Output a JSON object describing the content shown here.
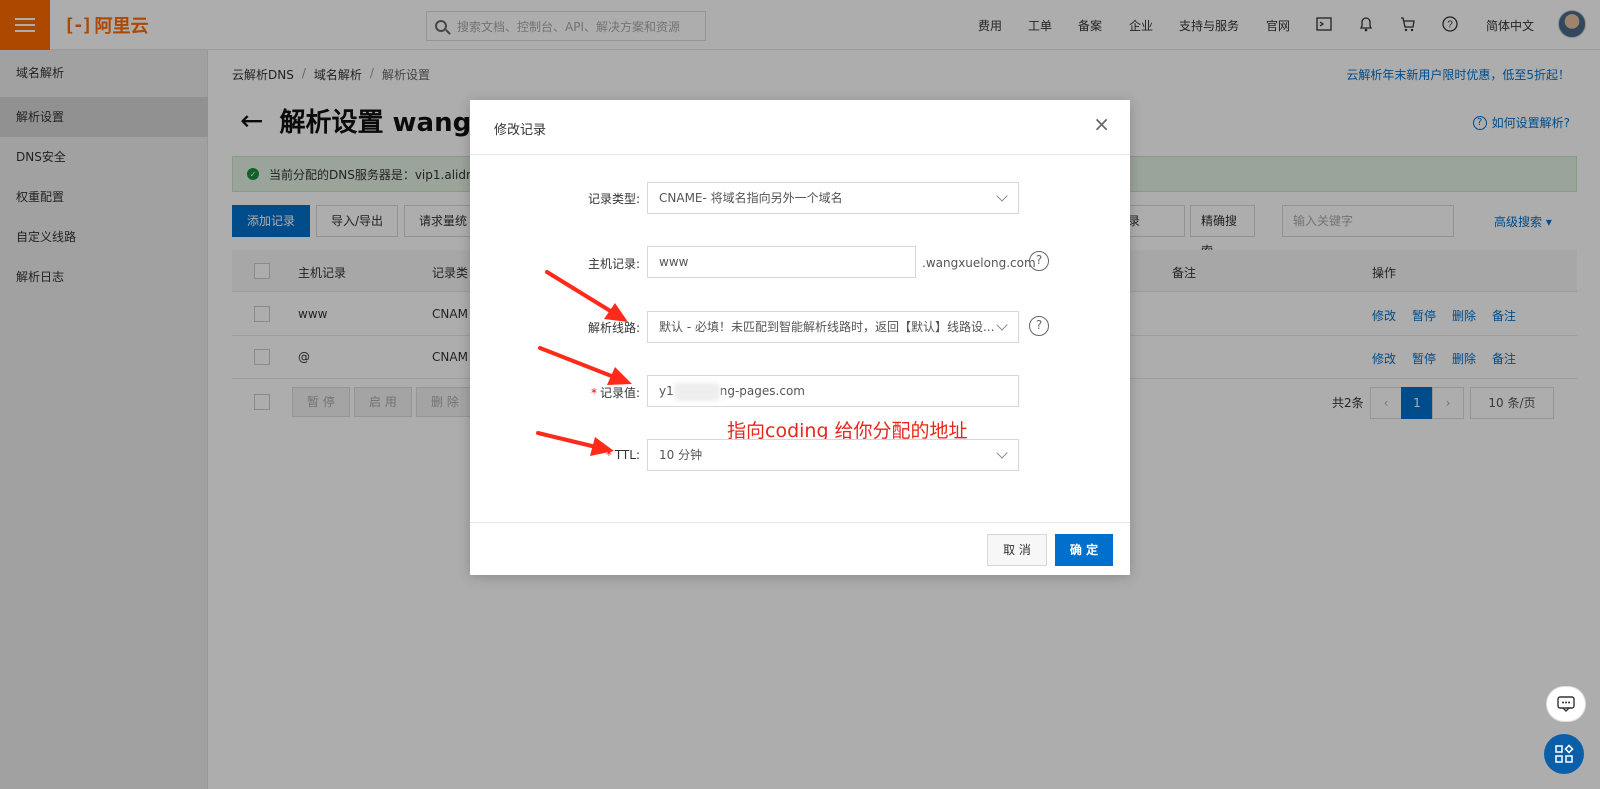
{
  "header": {
    "logo_text": "阿里云",
    "search_placeholder": "搜索文档、控制台、API、解决方案和资源",
    "nav": [
      "费用",
      "工单",
      "备案",
      "企业",
      "支持与服务",
      "官网"
    ],
    "language": "简体中文",
    "brand_color": "#ff6a00"
  },
  "sidebar": {
    "items": [
      {
        "label": "域名解析"
      },
      {
        "label": "解析设置"
      },
      {
        "label": "DNS安全"
      },
      {
        "label": "权重配置"
      },
      {
        "label": "自定义线路"
      },
      {
        "label": "解析日志"
      }
    ],
    "active_index": 1
  },
  "main": {
    "breadcrumb": [
      "云解析DNS",
      "域名解析",
      "解析设置"
    ],
    "promo": "云解析年末新用户限时优惠，低至5折起！",
    "title": "解析设置 wang",
    "help_link": "如何设置解析?",
    "notice": "当前分配的DNS服务器是：vip1.alidns.",
    "toolbar": {
      "add": "添加记录",
      "import_export": "导入/导出",
      "request_stats": "请求量统",
      "record_filter": "记录",
      "precise_search": "精确搜索",
      "keyword_placeholder": "输入关键字",
      "advanced": "高级搜索 ▾"
    },
    "table": {
      "headers": {
        "host": "主机记录",
        "type": "记录类",
        "remark": "备注",
        "ops": "操作"
      },
      "rows": [
        {
          "host": "www",
          "type": "CNAM"
        },
        {
          "host": "@",
          "type": "CNAM"
        }
      ],
      "ops": [
        "修改",
        "暂停",
        "删除",
        "备注"
      ],
      "bulk": [
        "暂 停",
        "启 用",
        "删 除"
      ]
    },
    "pagination": {
      "total": "共2条",
      "current": "1",
      "page_size": "10 条/页"
    }
  },
  "dialog": {
    "title": "修改记录",
    "fields": {
      "type_label": "记录类型:",
      "type_value": "CNAME- 将域名指向另外一个域名",
      "host_label": "主机记录:",
      "host_value": "www",
      "host_suffix": ".wangxuelong.com",
      "line_label": "解析线路:",
      "line_value": "默认 - 必填！未匹配到智能解析线路时，返回【默认】线路设...",
      "value_label": "记录值:",
      "value_prefix": "y1",
      "value_suffix": "ng-pages.com",
      "ttl_label": "TTL:",
      "ttl_value": "10 分钟"
    },
    "annotation": "指向coding 给你分配的地址",
    "cancel": "取 消",
    "ok": "确 定"
  }
}
